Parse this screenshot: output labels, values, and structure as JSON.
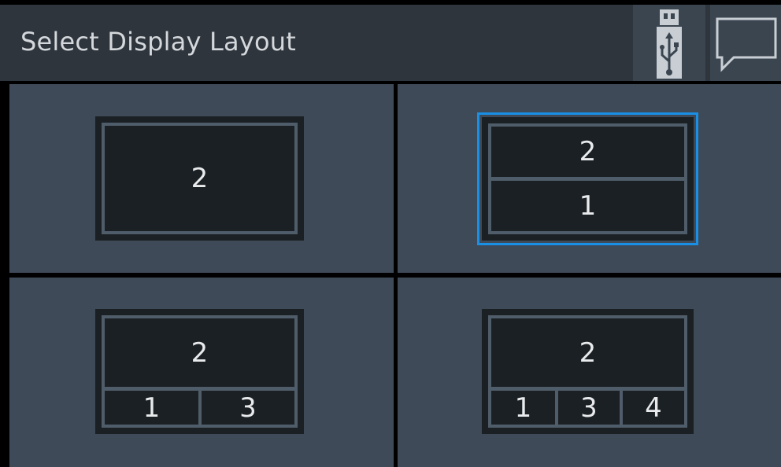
{
  "header": {
    "title": "Select Display Layout",
    "usb_icon": "usb-stick-icon",
    "message_icon": "speech-bubble-icon"
  },
  "layouts": [
    {
      "id": "single",
      "cells": [
        "2"
      ],
      "selected": false
    },
    {
      "id": "split-2",
      "cells": [
        "2",
        "1"
      ],
      "selected": true
    },
    {
      "id": "split-3",
      "cells": [
        "2",
        "1",
        "3"
      ],
      "selected": false
    },
    {
      "id": "split-4",
      "cells": [
        "2",
        "1",
        "3",
        "4"
      ],
      "selected": false
    }
  ],
  "colors": {
    "selected_border": "#1a8fe6",
    "tile_background": "#3e4a57",
    "header_background": "#2e353d"
  }
}
